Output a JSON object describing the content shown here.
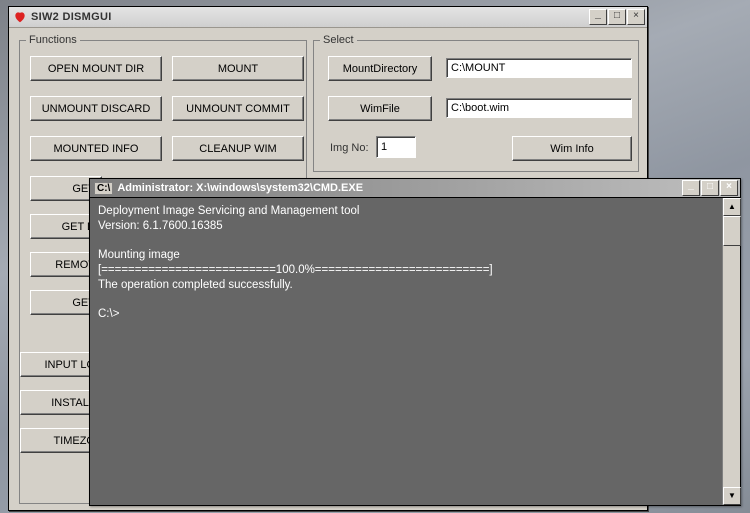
{
  "app": {
    "title": "SIW2 DISMGUI",
    "icon": "heart-icon"
  },
  "winbuttons": {
    "min": "_",
    "max": "□",
    "close": "×"
  },
  "functions": {
    "legend": "Functions",
    "open_mount_dir": "OPEN MOUNT DIR",
    "mount": "MOUNT",
    "unmount_discard": "UNMOUNT DISCARD",
    "unmount_commit": "UNMOUNT COMMIT",
    "mounted_info": "MOUNTED INFO",
    "cleanup_wim": "CLEANUP WIM",
    "get1": "GET",
    "get_d": "GET D",
    "remot": "REMOT",
    "get2": "GET",
    "input_lo": "INPUT LO",
    "install": "INSTALL",
    "timezo": "TIMEZO"
  },
  "select": {
    "legend": "Select",
    "mountdir_btn": "MountDirectory",
    "mountdir_value": "C:\\MOUNT",
    "wimfile_btn": "WimFile",
    "wimfile_value": "C:\\boot.wim",
    "imgno_label": "Img No:",
    "imgno_value": "1",
    "wiminfo_btn": "Wim Info"
  },
  "cmd": {
    "title": "Administrator: X:\\windows\\system32\\CMD.EXE",
    "line1": "Deployment Image Servicing and Management tool",
    "line2": "Version: 6.1.7600.16385",
    "line3": "Mounting image",
    "line4": "[==========================100.0%==========================]",
    "line5": "The operation completed successfully.",
    "prompt": "C:\\>"
  },
  "scrollglyph": {
    "up": "▲",
    "down": "▼"
  }
}
